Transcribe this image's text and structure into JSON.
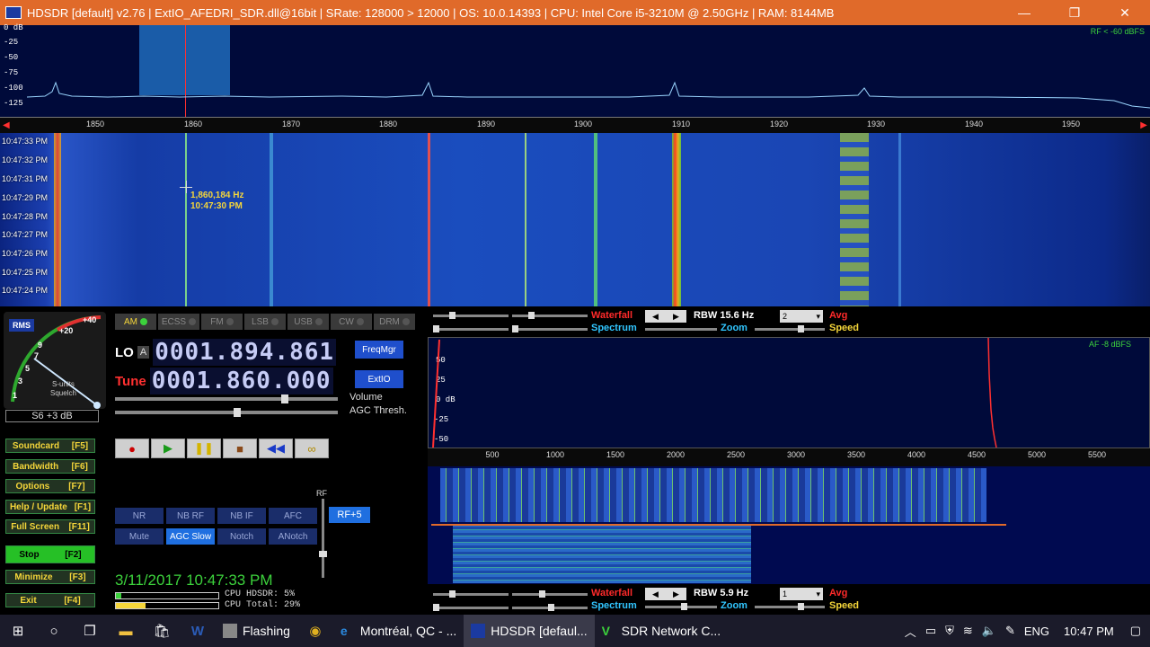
{
  "titlebar": {
    "text": "HDSDR  [default]  v2.76   |  ExtIO_AFEDRI_SDR.dll@16bit  |  SRate: 128000 > 12000  |  OS: 10.0.14393    |  CPU: Intel Core i5-3210M @ 2.50GHz  |  RAM: 8144MB",
    "minimize": "—",
    "maximize": "❐",
    "close": "✕"
  },
  "rf_spectrum": {
    "rf_indicator": "RF < -60 dBFS",
    "db_labels": [
      "0 dB",
      "-25",
      "-50",
      "-75",
      "-100",
      "-125"
    ],
    "freq_ticks": [
      "1850",
      "1860",
      "1870",
      "1880",
      "1890",
      "1900",
      "1910",
      "1920",
      "1930",
      "1940",
      "1950"
    ]
  },
  "waterfall": {
    "times": [
      "10:47:33 PM",
      "10:47:32 PM",
      "10:47:31 PM",
      "10:47:29 PM",
      "10:47:28 PM",
      "10:47:27 PM",
      "10:47:26 PM",
      "10:47:25 PM",
      "10:47:24 PM"
    ],
    "cursor_freq": "1,860,184 Hz",
    "cursor_time": "10:47:30 PM"
  },
  "smeter": {
    "rms": "RMS",
    "scale": [
      "+40",
      "+20",
      "9",
      "7",
      "5",
      "3",
      "1"
    ],
    "units": "S-units",
    "squelch": "Squelch",
    "reading": "S6 +3 dB",
    "needle_angle_deg": 36
  },
  "modes": [
    {
      "label": "AM",
      "active": true
    },
    {
      "label": "ECSS",
      "active": false
    },
    {
      "label": "FM",
      "active": false
    },
    {
      "label": "LSB",
      "active": false
    },
    {
      "label": "USB",
      "active": false
    },
    {
      "label": "CW",
      "active": false
    },
    {
      "label": "DRM",
      "active": false
    }
  ],
  "lo": {
    "label": "LO",
    "ab": "A",
    "value": "0001.894.861"
  },
  "tune": {
    "label": "Tune",
    "value": "0001.860.000"
  },
  "buttons": {
    "freqmgr": "FreqMgr",
    "extio": "ExtIO"
  },
  "sliders": {
    "volume_label": "Volume",
    "agc_label": "AGC Thresh.",
    "volume_level": 0.77,
    "agc_level": 0.55
  },
  "menu": [
    {
      "label": "Soundcard",
      "key": "[F5]"
    },
    {
      "label": "Bandwidth",
      "key": "[F6]"
    },
    {
      "label": "Options",
      "key": "[F7]"
    },
    {
      "label": "Help / Update",
      "key": "[F1]"
    },
    {
      "label": "Full Screen",
      "key": "[F11]"
    },
    {
      "label": "Stop",
      "key": "[F2]"
    },
    {
      "label": "Minimize",
      "key": "[F3]"
    },
    {
      "label": "Exit",
      "key": "[F4]"
    }
  ],
  "dsp": {
    "row1": [
      "NR",
      "NB RF",
      "NB IF",
      "AFC"
    ],
    "row2": [
      "Mute",
      "AGC Slow",
      "Notch",
      "ANotch"
    ],
    "rf_label": "RF",
    "rf_plus": "RF+5"
  },
  "status": {
    "datetime": "3/11/2017 10:47:33 PM",
    "cpu_hdsdr": "CPU HDSDR:  5%",
    "cpu_total": "CPU Total: 29%",
    "cpu_hdsdr_level": 0.05,
    "cpu_total_level": 0.29
  },
  "audio_top": {
    "waterfall": "Waterfall",
    "spectrum": "Spectrum",
    "rbw": "RBW 15.6 Hz",
    "dropdown": "2",
    "avg": "Avg",
    "zoom": "Zoom",
    "speed": "Speed"
  },
  "audio_spectrum": {
    "af_indicator": "AF -8 dBFS",
    "db_labels": [
      "50",
      "25",
      "0 dB",
      "-25",
      "-50"
    ],
    "freq_ticks": [
      "500",
      "1000",
      "1500",
      "2000",
      "2500",
      "3000",
      "3500",
      "4000",
      "4500",
      "5000",
      "5500"
    ]
  },
  "audio_bottom": {
    "waterfall": "Waterfall",
    "spectrum": "Spectrum",
    "rbw": "RBW  5.9 Hz",
    "dropdown": "1",
    "avg": "Avg",
    "zoom": "Zoom",
    "speed": "Speed"
  },
  "taskbar": {
    "apps": [
      {
        "label": "Flashing",
        "active": false
      },
      {
        "label": "Montréal, QC - ...",
        "active": false
      },
      {
        "label": "HDSDR  [defaul...",
        "active": true
      },
      {
        "label": "SDR Network C...",
        "active": false
      }
    ],
    "lang": "ENG",
    "time": "10:47 PM"
  },
  "colors": {
    "title_orange": "#e06a2a",
    "accent_blue": "#1f6fe0",
    "meter_green": "#3cd23c",
    "label_red": "#ff2a2a",
    "label_cyan": "#31c6ff"
  }
}
